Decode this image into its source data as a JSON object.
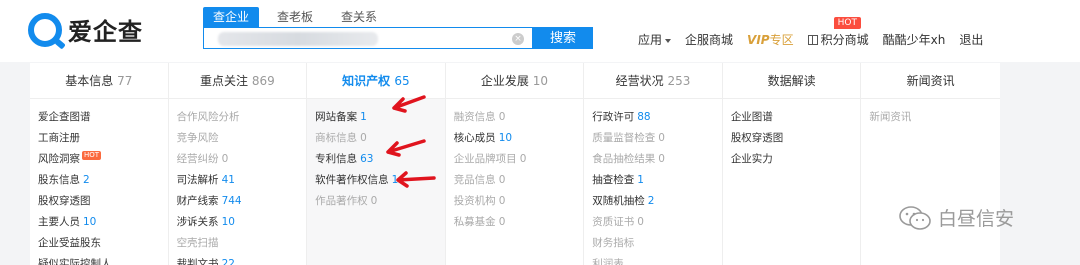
{
  "logo": {
    "text": "爱企查"
  },
  "search": {
    "tabs": [
      "查企业",
      "查老板",
      "查关系"
    ],
    "button": "搜索"
  },
  "nav": {
    "apps": "应用",
    "mall": "企服商城",
    "vip": "VIP",
    "vip_suffix": "专区",
    "points": "积分商城",
    "hot": "HOT",
    "user": "酷酷少年xh",
    "logout": "退出"
  },
  "tabs": [
    {
      "label": "基本信息",
      "count": "77"
    },
    {
      "label": "重点关注",
      "count": "869"
    },
    {
      "label": "知识产权",
      "count": "65"
    },
    {
      "label": "企业发展",
      "count": "10"
    },
    {
      "label": "经营状况",
      "count": "253"
    },
    {
      "label": "数据解读",
      "count": ""
    },
    {
      "label": "新闻资讯",
      "count": ""
    }
  ],
  "columns": [
    {
      "items": [
        {
          "label": "爱企查图谱",
          "count": ""
        },
        {
          "label": "工商注册",
          "count": ""
        },
        {
          "label": "风险洞察",
          "count": "",
          "badge": "HOT"
        },
        {
          "label": "股东信息",
          "count": "2"
        },
        {
          "label": "股权穿透图",
          "count": ""
        },
        {
          "label": "主要人员",
          "count": "10"
        },
        {
          "label": "企业受益股东",
          "count": ""
        },
        {
          "label": "疑似实际控制人",
          "count": ""
        }
      ]
    },
    {
      "items": [
        {
          "label": "合作风险分析",
          "count": "",
          "off": true
        },
        {
          "label": "竞争风险",
          "count": "",
          "off": true
        },
        {
          "label": "经营纠纷",
          "count": "0",
          "off": true
        },
        {
          "label": "司法解析",
          "count": "41"
        },
        {
          "label": "财产线索",
          "count": "744"
        },
        {
          "label": "涉诉关系",
          "count": "10"
        },
        {
          "label": "空壳扫描",
          "count": "",
          "off": true
        },
        {
          "label": "裁判文书",
          "count": "22"
        }
      ]
    },
    {
      "items": [
        {
          "label": "网站备案",
          "count": "1"
        },
        {
          "label": "商标信息",
          "count": "0",
          "off": true
        },
        {
          "label": "专利信息",
          "count": "63"
        },
        {
          "label": "软件著作权信息",
          "count": "1"
        },
        {
          "label": "作品著作权",
          "count": "0",
          "off": true
        }
      ]
    },
    {
      "items": [
        {
          "label": "融资信息",
          "count": "0",
          "off": true
        },
        {
          "label": "核心成员",
          "count": "10"
        },
        {
          "label": "企业品牌项目",
          "count": "0",
          "off": true
        },
        {
          "label": "竞品信息",
          "count": "0",
          "off": true
        },
        {
          "label": "投资机构",
          "count": "0",
          "off": true
        },
        {
          "label": "私募基金",
          "count": "0",
          "off": true
        }
      ]
    },
    {
      "items": [
        {
          "label": "行政许可",
          "count": "88"
        },
        {
          "label": "质量监督检查",
          "count": "0",
          "off": true
        },
        {
          "label": "食品抽检结果",
          "count": "0",
          "off": true
        },
        {
          "label": "抽查检查",
          "count": "1"
        },
        {
          "label": "双随机抽检",
          "count": "2"
        },
        {
          "label": "资质证书",
          "count": "0",
          "off": true
        },
        {
          "label": "财务指标",
          "count": "",
          "off": true
        },
        {
          "label": "利润表",
          "count": "",
          "off": true
        }
      ]
    },
    {
      "items": [
        {
          "label": "企业图谱",
          "count": ""
        },
        {
          "label": "股权穿透图",
          "count": ""
        },
        {
          "label": "企业实力",
          "count": ""
        }
      ]
    },
    {
      "items": [
        {
          "label": "新闻资讯",
          "count": "",
          "off": true
        }
      ]
    }
  ],
  "watermark": {
    "text": "白昼信安",
    "icon": "wechat-icon"
  },
  "colors": {
    "brand": "#128bed",
    "hot": "#fb4d3e",
    "arrow": "#e0141e",
    "vip": "#d9a03a"
  }
}
